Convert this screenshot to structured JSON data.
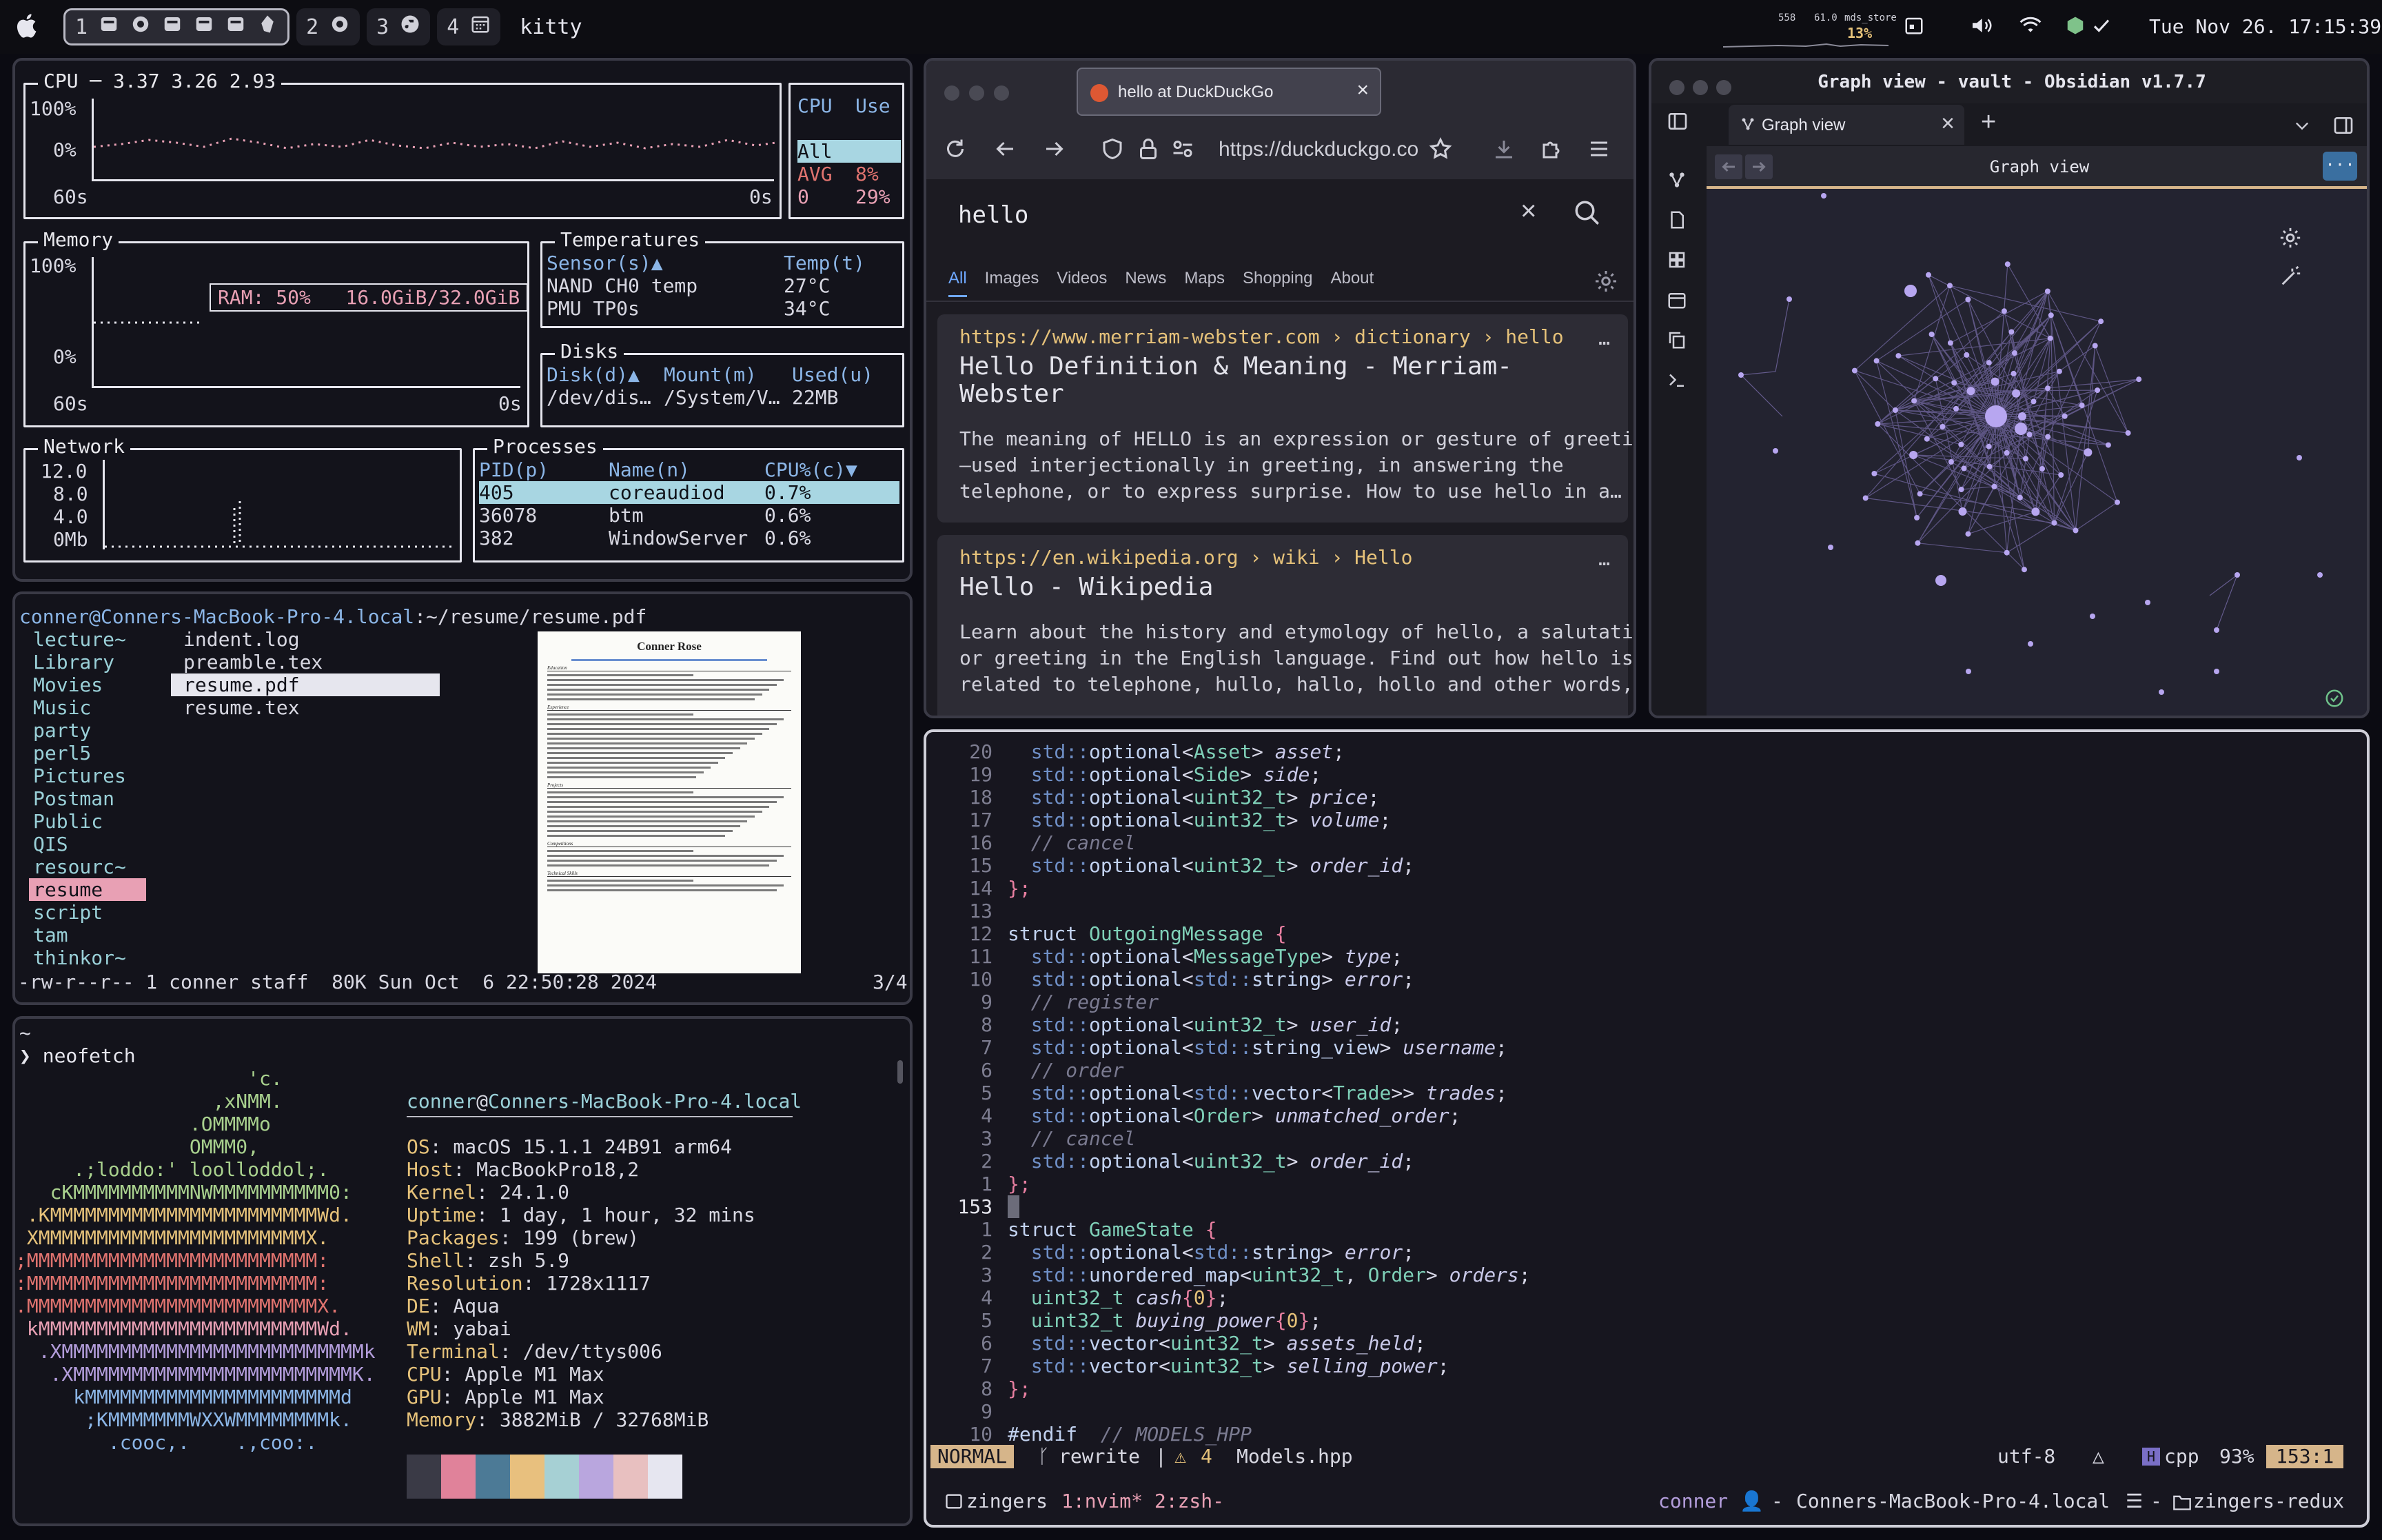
{
  "menubar": {
    "app_name": "kitty",
    "workspaces": [
      {
        "num": "1"
      },
      {
        "num": "2"
      },
      {
        "num": "3"
      },
      {
        "num": "4"
      }
    ],
    "net_up": "558",
    "net_down": "61.0",
    "net_proc": "mds_store",
    "cpu_pct": "13%",
    "datetime": "Tue Nov 26. 17:15:39"
  },
  "btm": {
    "cpu_title": "CPU ─ 3.37 3.26 2.93",
    "cpu_max": "100%",
    "cpu_min": "0%",
    "cpu_t0": "60s",
    "cpu_t1": "0s",
    "cpu_table": {
      "h1": "CPU",
      "h2": "Use",
      "rows": [
        [
          "All",
          ""
        ],
        [
          "AVG",
          "8%"
        ],
        [
          "0",
          "29%"
        ]
      ]
    },
    "mem_title": "Memory",
    "mem_max": "100%",
    "mem_min": "0%",
    "mem_t0": "60s",
    "mem_t1": "0s",
    "ram": "RAM: 50%   16.0GiB/32.0GiB",
    "temps": {
      "title": "Temperatures",
      "h1": "Sensor(s)▲",
      "h2": "Temp(t)",
      "rows": [
        [
          "NAND CH0 temp",
          "27°C"
        ],
        [
          "PMU TP0s",
          "34°C"
        ]
      ]
    },
    "disks": {
      "title": "Disks",
      "h1": "Disk(d)▲",
      "h2": "Mount(m)",
      "h3": "Used(u)",
      "row": [
        "/dev/dis…",
        "/System/V…",
        "22MB"
      ]
    },
    "net": {
      "title": "Network",
      "ticks": [
        "12.0",
        "8.0",
        "4.0",
        "0Mb"
      ]
    },
    "procs": {
      "title": "Processes",
      "h1": "PID(p)",
      "h2": "Name(n)",
      "h3": "CPU%(c)▼",
      "rows": [
        [
          "405",
          "coreaudiod",
          "0.7%"
        ],
        [
          "36078",
          "btm",
          "0.6%"
        ],
        [
          "382",
          "WindowServer",
          "0.6%"
        ]
      ]
    }
  },
  "ranger": {
    "path_user": "conner@Conners-MacBook-Pro-4.local",
    "path": ":~/resume/resume.pdf",
    "dirs": [
      "lecture~",
      "Library",
      "Movies",
      "Music",
      "party",
      "perl5",
      "Pictures",
      "Postman",
      "Public",
      "QIS",
      "resourc~",
      "resume",
      "script",
      "tam",
      "thinkor~"
    ],
    "files": [
      "indent.log",
      "preamble.tex",
      "resume.pdf",
      "resume.tex"
    ],
    "status": "-rw-r--r-- 1 conner staff  80K Sun Oct  6 22:50:28 2024",
    "count": "3/4",
    "preview": {
      "name": "Conner Rose",
      "sections": [
        "Education",
        "Experience",
        "Projects",
        "Competitions",
        "Technical Skills"
      ]
    }
  },
  "neofetch": {
    "tilde": "~",
    "cmd": "❯ neofetch",
    "user": "conner",
    "host": "Conners-MacBook-Pro-4.local",
    "rule": "────────────────────────────────────────────────────────────────────────────────",
    "info": [
      [
        "OS",
        "macOS 15.1.1 24B91 arm64"
      ],
      [
        "Host",
        "MacBookPro18,2"
      ],
      [
        "Kernel",
        "24.1.0"
      ],
      [
        "Uptime",
        "1 day, 1 hour, 32 mins"
      ],
      [
        "Packages",
        "199 (brew)"
      ],
      [
        "Shell",
        "zsh 5.9"
      ],
      [
        "Resolution",
        "1728x1117"
      ],
      [
        "DE",
        "Aqua"
      ],
      [
        "WM",
        "yabai"
      ],
      [
        "Terminal",
        "/dev/ttys006"
      ],
      [
        "CPU",
        "Apple M1 Max"
      ],
      [
        "GPU",
        "Apple M1 Max"
      ],
      [
        "Memory",
        "3882MiB / 32768MiB"
      ]
    ],
    "logo": [
      "                    'c.",
      "                 ,xNMM.",
      "               .OMMMMo",
      "               OMMM0,",
      "     .;loddo:' loolloddol;.",
      "   cKMMMMMMMMMMNWMMMMMMMMMM0:",
      " .KMMMMMMMMMMMMMMMMMMMMMMMWd.",
      " XMMMMMMMMMMMMMMMMMMMMMMMX.",
      ";MMMMMMMMMMMMMMMMMMMMMMMMM:",
      ":MMMMMMMMMMMMMMMMMMMMMMMMM:",
      ".MMMMMMMMMMMMMMMMMMMMMMMMMX.",
      " kMMMMMMMMMMMMMMMMMMMMMMMMWd.",
      "  .XMMMMMMMMMMMMMMMMMMMMMMMMMMk",
      "   .XMMMMMMMMMMMMMMMMMMMMMMMMK.",
      "     kMMMMMMMMMMMMMMMMMMMMMMd",
      "      ;KMMMMMMMWXXWMMMMMMMMk.",
      "        .cooc,.    .,coo:."
    ],
    "colors": [
      "#3a3a46",
      "#e0829a",
      "#4c7a96",
      "#e8c07e",
      "#a6d0d4",
      "#b9a6de",
      "#e8c0c0",
      "#e6e6f0"
    ]
  },
  "browser": {
    "tab_title": "hello at DuckDuckGo",
    "url": "https://duckduckgo.com",
    "query": "hello",
    "nav": [
      "All",
      "Images",
      "Videos",
      "News",
      "Maps",
      "Shopping",
      "About"
    ],
    "results": [
      {
        "crumb": "https://www.merriam-webster.com › dictionary › hello",
        "title1": "Hello Definition & Meaning - Merriam-",
        "title2": "Webster",
        "s1": "The meaning of HELLO is an expression or gesture of greeting",
        "s2": "–used interjectionally in greeting, in answering the",
        "s3": "telephone, or to express surprise. How to use hello in a…"
      },
      {
        "crumb": "https://en.wikipedia.org › wiki › Hello",
        "title1": "Hello - Wikipedia",
        "s1": "Learn about the history and etymology of hello, a salutation",
        "s2": "or greeting in the English language. Find out how hello is",
        "s3": "related to telephone, hullo, hallo, hollo and other words,…"
      }
    ]
  },
  "obsidian": {
    "window_title": "Graph view - vault - Obsidian v1.7.7",
    "tab": "Graph view",
    "header": "Graph view"
  },
  "nvim": {
    "mode": "NORMAL",
    "branch": "rewrite",
    "warnings": "4",
    "file": "Models.hpp",
    "enc": "utf-8",
    "ft": "cpp",
    "pct": "93%",
    "pos": "153:1",
    "session": "zingers",
    "windows": "1:nvim* 2:zsh-",
    "user": "conner",
    "host": "Conners-MacBook-Pro-4.local",
    "dir": "zingers-redux"
  }
}
